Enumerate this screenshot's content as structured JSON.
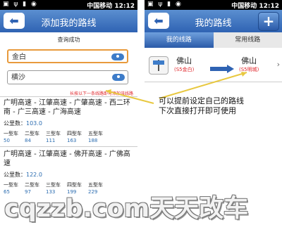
{
  "status_bar": {
    "icons": "▣ ψ ▮ ◉",
    "carrier": "中国移动",
    "time": "12:12"
  },
  "left_screen": {
    "title": "添加我的路线",
    "query_status": "查询成功",
    "origin_value": "金白",
    "destination_value": "横沙",
    "hint": "长按以下一条线路即可添加该线路",
    "vehicle_headers": [
      "一型车",
      "二型车",
      "三型车",
      "四型车",
      "五型车"
    ],
    "routes": [
      {
        "name": "广明高速 - 江肇高速 - 广肇高速 - 西二环南 - 广三高速 - 广海高速",
        "distance_label": "公里数：",
        "distance_value": "103.0",
        "prices": [
          "50",
          "84",
          "111",
          "163",
          "188"
        ]
      },
      {
        "name": "广明高速 - 江肇高速 - 佛开高速 - 广佛高速",
        "distance_label": "公里数：",
        "distance_value": "122.0",
        "prices": [
          "65",
          "97",
          "133",
          "199",
          "229"
        ]
      }
    ]
  },
  "right_screen": {
    "title": "我的路线",
    "tabs": [
      "我的线路",
      "常用线路"
    ],
    "active_tab": 0,
    "route_item": {
      "from_city": "佛山",
      "from_sub": "(S5金白)",
      "to_city": "佛山",
      "to_sub": "(S5明城)"
    }
  },
  "annotation": {
    "line1": "可以提前设定自己的路线",
    "line2": "下次直接打开即可使用"
  },
  "watermark": "cqzzb.com天天改车",
  "colors": {
    "titlebar": "#2f63b3",
    "accent_red": "#e0262b",
    "link_blue": "#2b6cb0",
    "input_focus": "#e89a3c",
    "callout": "#e8c840"
  }
}
